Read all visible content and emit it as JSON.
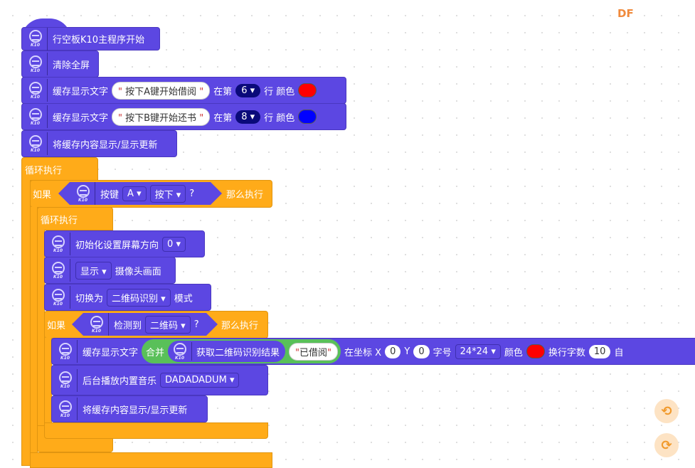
{
  "logo": "DF",
  "k10_label": "K10",
  "blocks": {
    "hat": "行空板K10主程序开始",
    "clear": "清除全屏",
    "cache1": {
      "label": "缓存显示文字",
      "text": "按下A键开始借阅",
      "at": "在第",
      "row": "6",
      "row_suffix": "行 颜色",
      "color": "#ff0000"
    },
    "cache2": {
      "label": "缓存显示文字",
      "text": "按下B键开始还书",
      "at": "在第",
      "row": "8",
      "row_suffix": "行 颜色",
      "color": "#0000ff"
    },
    "refresh1": "将缓存内容显示/显示更新",
    "loop1": "循环执行",
    "if1": {
      "if": "如果",
      "key": "按键",
      "key_value": "A",
      "state": "按下",
      "q": "?",
      "then": "那么执行"
    },
    "loop2": "循环执行",
    "init": {
      "label": "初始化设置屏幕方向",
      "value": "0"
    },
    "camera": {
      "value": "显示",
      "label": "摄像头画面"
    },
    "switch": {
      "label": "切换为",
      "value": "二维码识别",
      "suffix": "模式"
    },
    "if2": {
      "if": "如果",
      "detect": "检测到",
      "value": "二维码",
      "q": "?",
      "then": "那么执行"
    },
    "cache3": {
      "label": "缓存显示文字",
      "join": "合并",
      "get": "获取二维码识别结果",
      "text": "已借阅",
      "at_x": "在坐标 X",
      "x": "0",
      "y_label": "Y",
      "y": "0",
      "size_label": "字号",
      "size": "24*24",
      "color_label": "颜色",
      "color": "#ff0000",
      "wrap_label": "换行字数",
      "wrap": "10",
      "auto": "自"
    },
    "music": {
      "label": "后台播放内置音乐",
      "value": "DADADADUM"
    },
    "refresh2": "将缓存内容显示/显示更新"
  },
  "quote": "\"",
  "dropdown_arrow": "▾",
  "undo_icon": "⟲",
  "redo_icon": "⟳"
}
